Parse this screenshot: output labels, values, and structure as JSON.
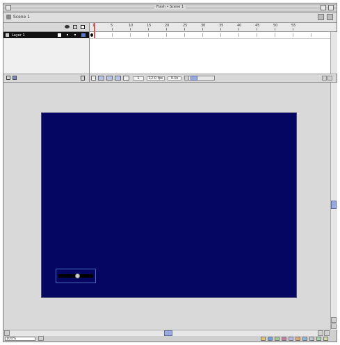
{
  "window": {
    "title": "Flash • Scene 1"
  },
  "scene_bar": {
    "scene_label": "Scene 1"
  },
  "timeline": {
    "layer_name": "Layer 1",
    "frame_numbers": [
      "1",
      "5",
      "10",
      "15",
      "20",
      "25",
      "30",
      "35",
      "40",
      "45",
      "50",
      "55"
    ],
    "current_frame": "1",
    "frame_rate": "12.0 fps",
    "elapsed_time": "0.0s"
  },
  "status": {
    "zoom": "100%"
  },
  "colors": {
    "stage_background": "#050562",
    "workspace": "#d9d9d9",
    "playhead": "#e05050"
  }
}
